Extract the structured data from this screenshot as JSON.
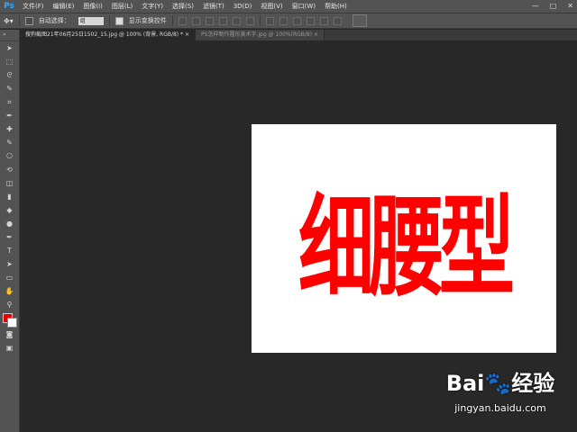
{
  "app": {
    "logo": "Ps"
  },
  "menubar": {
    "items": [
      "文件(F)",
      "编辑(E)",
      "图像(I)",
      "图层(L)",
      "文字(Y)",
      "选择(S)",
      "滤镜(T)",
      "3D(D)",
      "视图(V)",
      "窗口(W)",
      "帮助(H)"
    ],
    "window_controls": [
      "—",
      "□",
      "✕"
    ]
  },
  "options_bar": {
    "auto_select_label": "自动选择：",
    "auto_select_value": "组",
    "show_transform_label": "显示变换控件",
    "show_transform_checked": true,
    "auto_select_checked": false
  },
  "tabs": [
    {
      "label": "搜狗截图21年06月25日1502_15.jpg @ 100% (背景, RGB/8) *",
      "active": true,
      "close": "×"
    },
    {
      "label": "PS怎样制作圆形美术字.jpg @ 100%(RGB/8)",
      "active": false,
      "close": "×"
    }
  ],
  "toolbar": {
    "tools": [
      "move-tool",
      "marquee-tool",
      "lasso-tool",
      "quick-select-tool",
      "crop-tool",
      "eyedropper-tool",
      "healing-brush-tool",
      "brush-tool",
      "clone-stamp-tool",
      "history-brush-tool",
      "eraser-tool",
      "gradient-tool",
      "blur-tool",
      "dodge-tool",
      "pen-tool",
      "type-tool",
      "path-select-tool",
      "shape-tool",
      "hand-tool",
      "zoom-tool"
    ],
    "glyphs": [
      "➤",
      "⬚",
      "ᘓ",
      "✎",
      "⌗",
      "✒",
      "✚",
      "✎",
      "⎔",
      "⟲",
      "◫",
      "▮",
      "◆",
      "●",
      "✒",
      "T",
      "➤",
      "▭",
      "✋",
      "⚲"
    ],
    "foreground_color": "#e60000",
    "background_color": "#ffffff"
  },
  "canvas": {
    "text": "细腰型",
    "text_color": "#ff0000"
  },
  "watermark": {
    "brand": "Bai🐾经验",
    "url": "jingyan.baidu.com"
  }
}
